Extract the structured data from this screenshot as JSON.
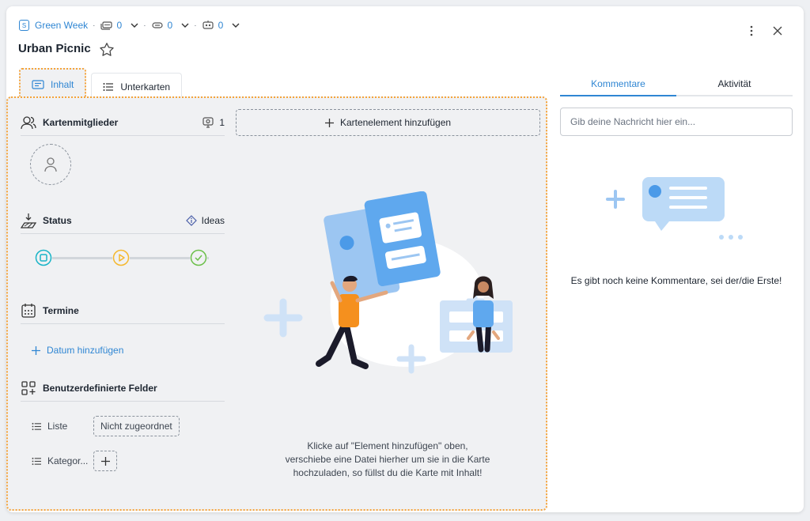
{
  "breadcrumb": {
    "board_badge": "S",
    "board_name": "Green Week",
    "counters": [
      {
        "icon": "card-stack-icon",
        "value": "0"
      },
      {
        "icon": "attachment-icon",
        "value": "0"
      },
      {
        "icon": "robot-icon",
        "value": "0"
      }
    ]
  },
  "card": {
    "title": "Urban Picnic"
  },
  "tabs": [
    {
      "label": "Inhalt",
      "icon": "card-content-icon",
      "active": true
    },
    {
      "label": "Unterkarten",
      "icon": "list-icon",
      "active": false
    }
  ],
  "sections": {
    "members": {
      "title": "Kartenmitglieder",
      "count": "1"
    },
    "status": {
      "title": "Status",
      "value": "Ideas"
    },
    "dates": {
      "title": "Termine",
      "add_label": "Datum hinzufügen"
    },
    "custom_fields": {
      "title": "Benutzerdefinierte Felder",
      "fields": [
        {
          "label": "Liste",
          "value": "Nicht zugeordnet"
        },
        {
          "label": "Kategor...",
          "value": ""
        }
      ]
    }
  },
  "add_element_label": "Kartenelement hinzufügen",
  "empty_state_text": "Klicke auf \"Element hinzufügen\" oben, verschiebe eine Datei hierher um sie in die Karte hochzuladen, so füllst du die Karte mit Inhalt!",
  "right_panel": {
    "tabs": [
      {
        "label": "Kommentare",
        "active": true
      },
      {
        "label": "Aktivität",
        "active": false
      }
    ],
    "input_placeholder": "Gib deine Nachricht hier ein...",
    "empty_text": "Es gibt noch keine Kommentare, sei der/die Erste!"
  },
  "colors": {
    "accent": "#2f86d3",
    "highlight": "#f5a43b",
    "status_todo": "#19b4c7",
    "status_doing": "#f5b82e",
    "status_done": "#6cc04a"
  }
}
